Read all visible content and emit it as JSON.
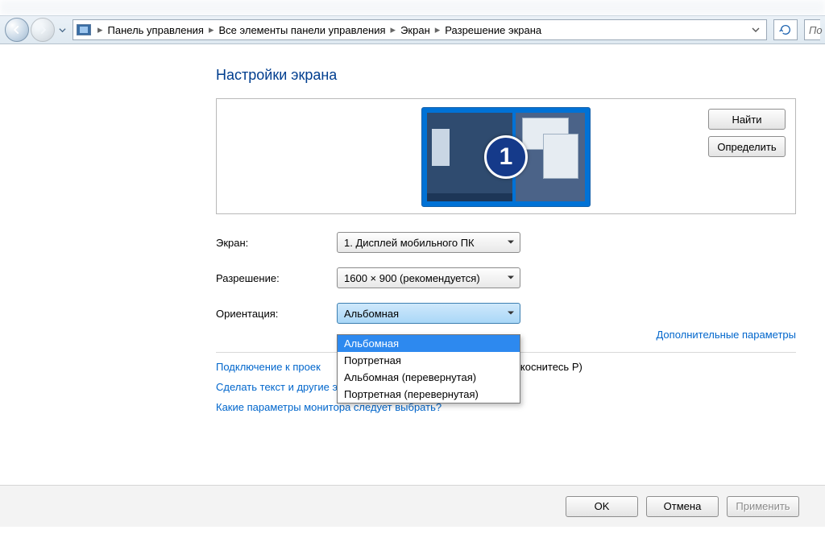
{
  "breadcrumb": {
    "items": [
      "Панель управления",
      "Все элементы панели управления",
      "Экран",
      "Разрешение экрана"
    ]
  },
  "search_fragment": "По",
  "page": {
    "title": "Настройки экрана",
    "monitor_badge": "1",
    "buttons": {
      "find": "Найти",
      "identify": "Определить"
    }
  },
  "form": {
    "screen_label": "Экран:",
    "screen_value": "1. Дисплей мобильного ПК",
    "resolution_label": "Разрешение:",
    "resolution_value": "1600 × 900 (рекомендуется)",
    "orientation_label": "Ориентация:",
    "orientation_value": "Альбомная",
    "orientation_options": [
      "Альбомная",
      "Портретная",
      "Альбомная (перевернутая)",
      "Портретная (перевернутая)"
    ]
  },
  "links": {
    "advanced": "Дополнительные параметры",
    "projector_pre": "Подключение к проек",
    "projector_post": "и коснитесь P)",
    "text_size": "Сделать текст и другие элементы больше или меньше",
    "which_settings": "Какие параметры монитора следует выбрать?"
  },
  "footer": {
    "ok": "OK",
    "cancel": "Отмена",
    "apply": "Применить"
  }
}
